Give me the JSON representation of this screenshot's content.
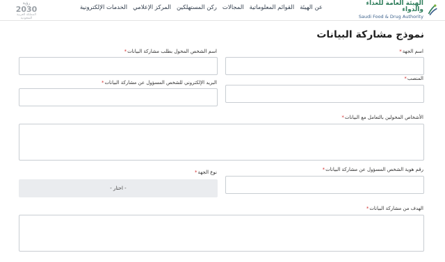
{
  "header": {
    "logo_ar": "الهيئة العامة للغذاء والدواء",
    "logo_en": "Saudi Food & Drug Authority",
    "nav": [
      "عن الهيئة",
      "القوائم المعلوماتية",
      "المجالات",
      "ركن المستهلكين",
      "المركز الإعلامي",
      "الخدمات الإلكترونية"
    ],
    "vision_top": "رؤية",
    "vision_num": "2030",
    "vision_sub": "المملكة العربية السعودية"
  },
  "form": {
    "title": "نموذج مشاركة البيانات",
    "required_mark": "*",
    "entity_name_label": "اسم الجهة",
    "authorized_person_label": "اسم الشخص المخول بطلب مشاركة البيانات",
    "position_label": "المنصب",
    "email_label": "البريد الإلكتروني للشخص المسؤول عن مشاركة البيانات",
    "authorized_persons_label": "الأشخاص المخولين بالتعامل مع البيانات",
    "id_number_label": "رقم هوية الشخص المسؤول عن مشاركة البيانات",
    "entity_type_label": "نوع الجهة",
    "entity_type_value": "- اختار -",
    "purpose_label": "الهدف من مشاركة البيانات"
  },
  "colors": {
    "required": "#d32f2f",
    "brand_green": "#2e7d5b",
    "brand_blue": "#3a5f8a"
  }
}
